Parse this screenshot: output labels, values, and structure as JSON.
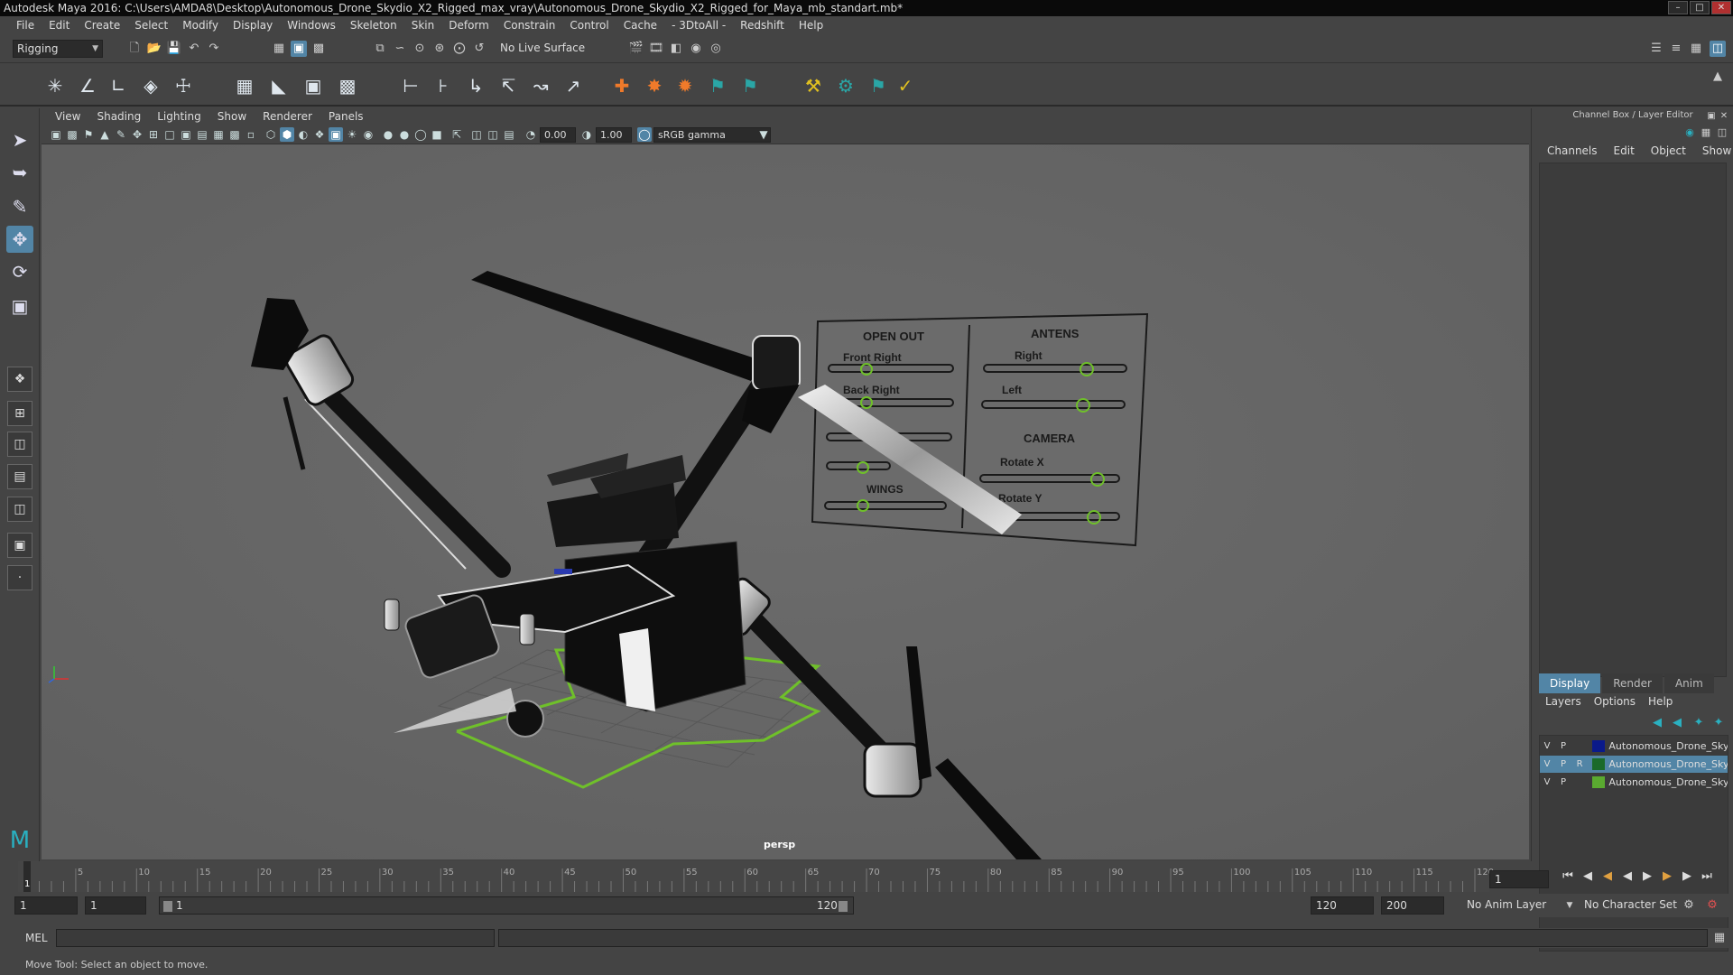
{
  "window": {
    "title": "Autodesk Maya 2016: C:\\Users\\AMDA8\\Desktop\\Autonomous_Drone_Skydio_X2_Rigged_max_vray\\Autonomous_Drone_Skydio_X2_Rigged_for_Maya_mb_standart.mb*"
  },
  "menubar": [
    "File",
    "Edit",
    "Create",
    "Select",
    "Modify",
    "Display",
    "Windows",
    "Skeleton",
    "Skin",
    "Deform",
    "Constrain",
    "Control",
    "Cache",
    "- 3DtoAll -",
    "Redshift",
    "Help"
  ],
  "statusline": {
    "menuset": "Rigging",
    "live_surface": "No Live Surface"
  },
  "panel": {
    "menus": [
      "View",
      "Shading",
      "Lighting",
      "Show",
      "Renderer",
      "Panels"
    ],
    "exposure": "0.00",
    "gamma": "1.00",
    "color_space": "sRGB gamma",
    "camera_label": "persp"
  },
  "scene_panel": {
    "open_out": "OPEN OUT",
    "front_right": "Front Right",
    "back_right": "Back Right",
    "wings": "WINGS",
    "antens": "ANTENS",
    "right": "Right",
    "left": "Left",
    "camera": "CAMERA",
    "rotate_x": "Rotate X",
    "rotate_y": "Rotate Y"
  },
  "channel_box": {
    "title": "Channel Box / Layer Editor",
    "menus": [
      "Channels",
      "Edit",
      "Object",
      "Show"
    ],
    "tabs": [
      "Display",
      "Render",
      "Anim"
    ],
    "layer_menus": [
      "Layers",
      "Options",
      "Help"
    ],
    "layers": [
      {
        "v": "V",
        "p": "P",
        "r": "",
        "color": "#0a1a8a",
        "name": "Autonomous_Drone_Skydio"
      },
      {
        "v": "V",
        "p": "P",
        "r": "R",
        "color": "#1a6a2a",
        "name": "Autonomous_Drone_Skydio"
      },
      {
        "v": "V",
        "p": "P",
        "r": "",
        "color": "#5aaa30",
        "name": "Autonomous_Drone_Skydio"
      }
    ]
  },
  "timeline": {
    "ticks": [
      "5",
      "10",
      "15",
      "20",
      "25",
      "30",
      "35",
      "40",
      "45",
      "50",
      "55",
      "60",
      "65",
      "70",
      "75",
      "80",
      "85",
      "90",
      "95",
      "100",
      "105",
      "110",
      "115",
      "120"
    ],
    "current_frame_marker": "1",
    "current_frame": "1"
  },
  "range": {
    "start": "1",
    "playback_start": "1",
    "slider_start": "1",
    "slider_end": "120",
    "playback_end": "120",
    "end": "200",
    "anim_layer": "No Anim Layer",
    "character_set": "No Character Set"
  },
  "cmdline": {
    "label": "MEL"
  },
  "helpline": {
    "text": "Move Tool: Select an object to move."
  },
  "colors": {
    "accent": "#5285a6",
    "viewport_bg": "#676767",
    "ground_outline": "#6fc02a"
  }
}
